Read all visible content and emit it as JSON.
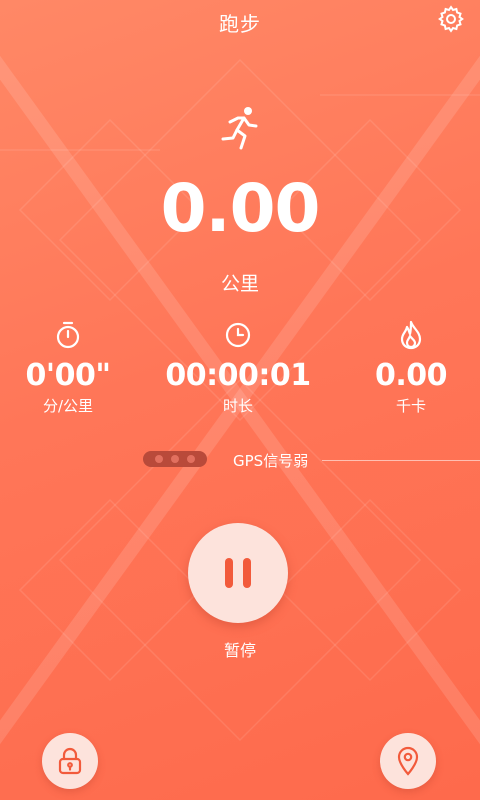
{
  "header": {
    "title": "跑步",
    "settings_icon": "gear-icon"
  },
  "distance": {
    "value": "0.00",
    "unit": "公里",
    "icon": "runner-icon"
  },
  "stats": [
    {
      "icon": "stopwatch-icon",
      "value": "0'00\"",
      "label": "分/公里"
    },
    {
      "icon": "clock-icon",
      "value": "00:00:01",
      "label": "时长"
    },
    {
      "icon": "flame-icon",
      "value": "0.00",
      "label": "千卡"
    }
  ],
  "gps": {
    "status": "GPS信号弱"
  },
  "controls": {
    "pause_label": "暂停",
    "lock_icon": "lock-icon",
    "location_icon": "location-pin-icon"
  },
  "colors": {
    "background_top": "#ff8866",
    "background_bottom": "#fe6a4c",
    "button_fill": "#fde3dc",
    "button_accent": "#f25a3b"
  }
}
